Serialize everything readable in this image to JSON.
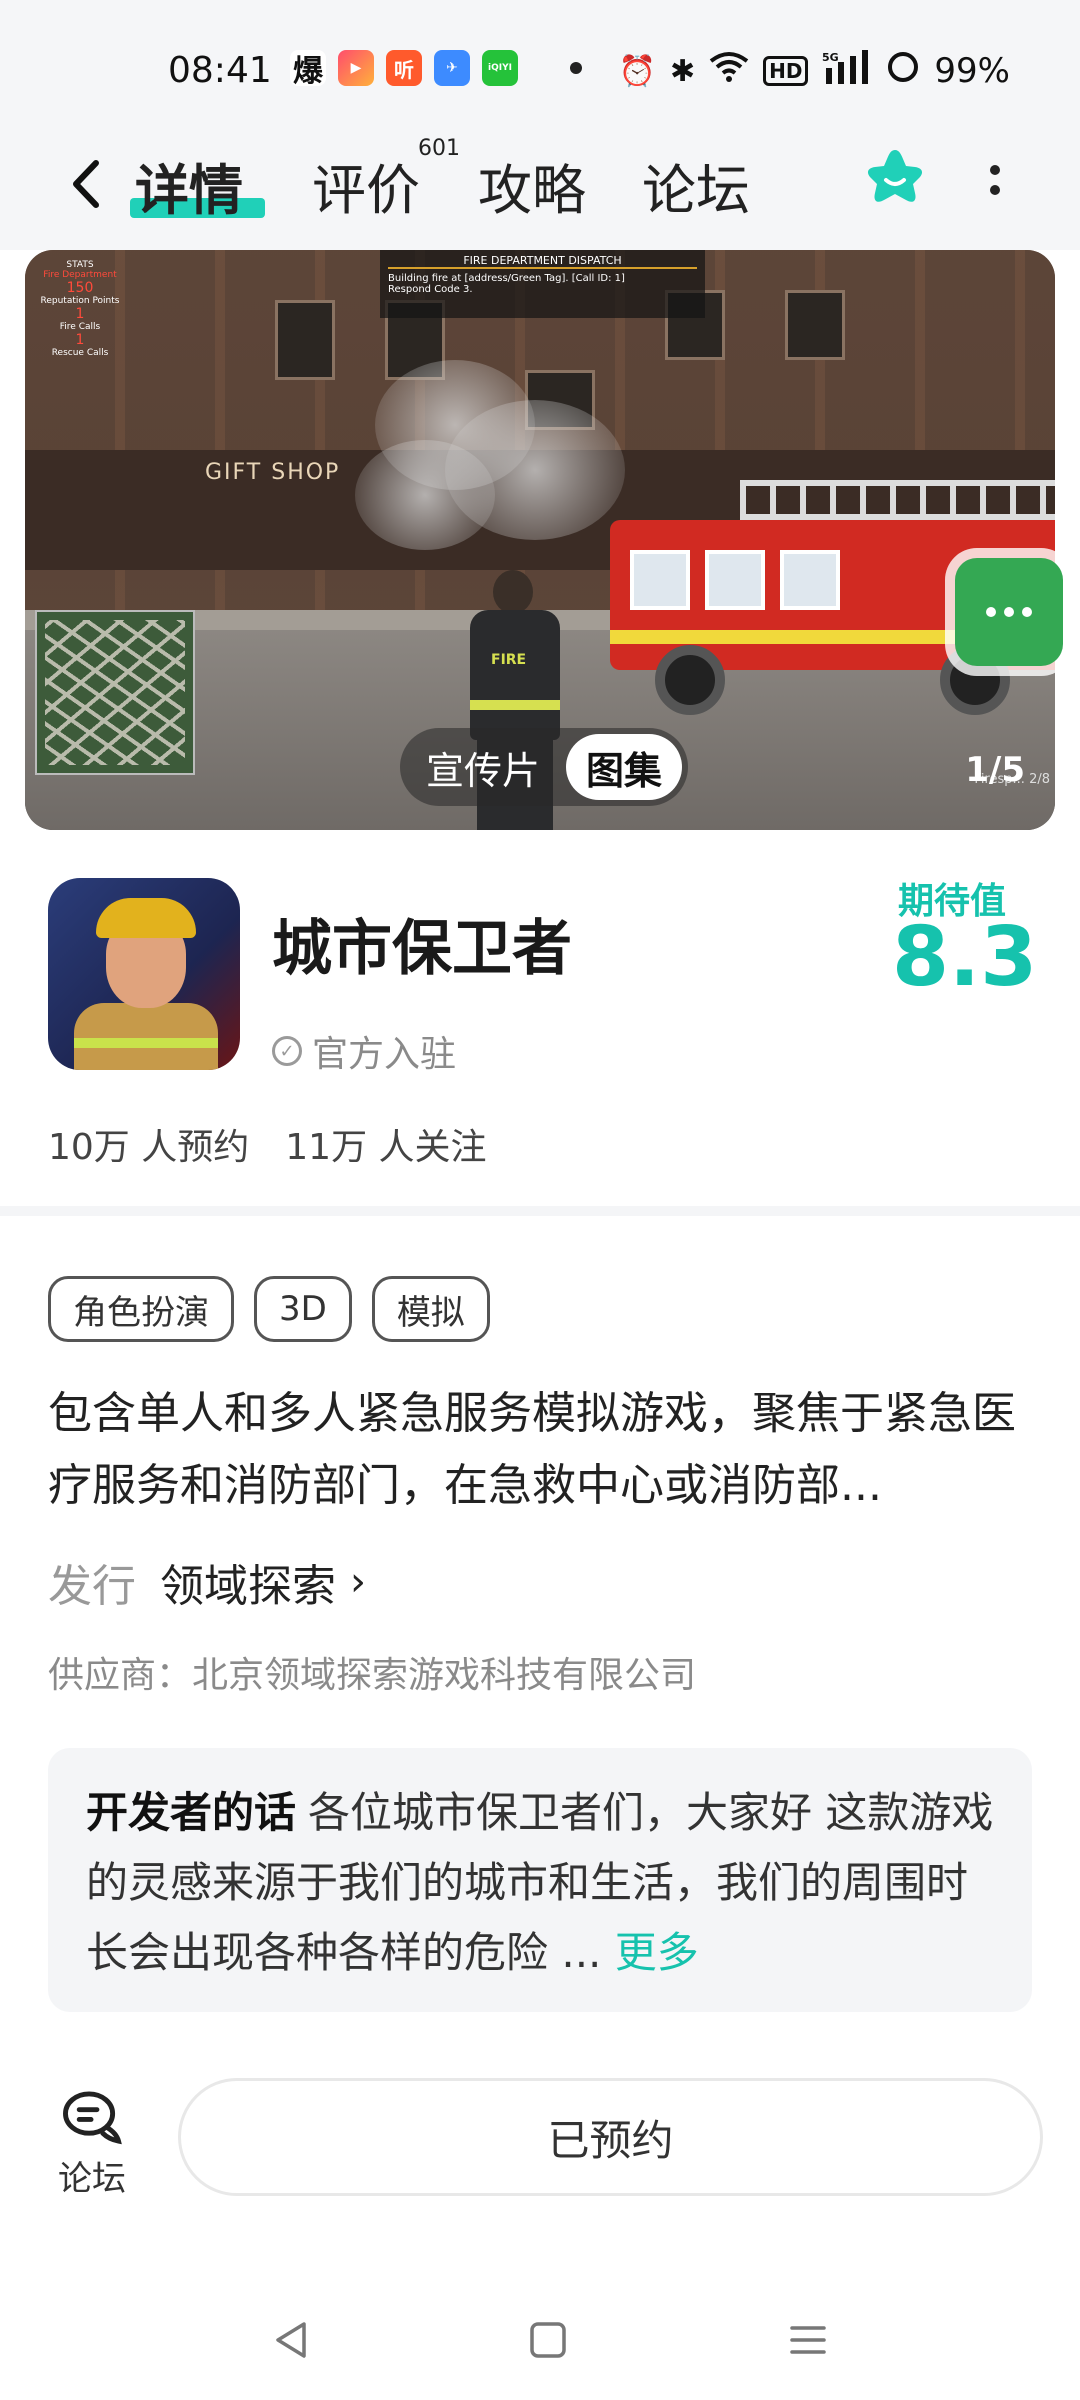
{
  "status_bar": {
    "time": "08:41",
    "battery": "99%",
    "icons": [
      "bao-icon",
      "app-icon",
      "ting-icon",
      "plane-icon",
      "iqiyi-icon",
      "alarm-icon",
      "bluetooth-icon",
      "wifi-icon",
      "hd-icon",
      "signal-icon"
    ],
    "signal_label": "5G",
    "hd_label": "HD",
    "apps": {
      "bao": "爆",
      "ting": "听",
      "iqiyi": "iQIYI"
    }
  },
  "nav": {
    "tabs": [
      {
        "label": "详情",
        "active": true
      },
      {
        "label": "评价",
        "badge": "601"
      },
      {
        "label": "攻略"
      },
      {
        "label": "论坛"
      }
    ]
  },
  "hero": {
    "toggle": [
      {
        "label": "宣传片",
        "active": false
      },
      {
        "label": "图集",
        "active": true
      }
    ],
    "counter": "1/5",
    "counter_sub": "Firesp... 2/8",
    "dispatch_title": "FIRE DEPARTMENT DISPATCH",
    "dispatch_line1": "Building fire at [address/Green Tag]. [Call ID: 1]",
    "dispatch_line2": "Respond Code 3.",
    "stats_title": "STATS",
    "stats_dept": "Fire Department",
    "stats_rep": "150",
    "stats_rep_label": "Reputation Points",
    "stats_fire": "1",
    "stats_fire_label": "Fire Calls",
    "stats_rescue": "1",
    "stats_rescue_label": "Rescue Calls",
    "shop_sign": "GIFT SHOP",
    "ff_text": "FIRE"
  },
  "game": {
    "title": "城市保卫者",
    "official": "官方入驻",
    "expect_label": "期待值",
    "expect_value": "8.3",
    "reservations": "10万 人预约",
    "followers": "11万 人关注",
    "tags": [
      "角色扮演",
      "3D",
      "模拟"
    ],
    "description": "包含单人和多人紧急服务模拟游戏，聚焦于紧急医疗服务和消防部门，在急救中心或消防部...",
    "publisher_label": "发行",
    "publisher_name": "领域探索",
    "supplier": "供应商：北京领域探索游戏科技有限公司",
    "dev_label": "开发者的话",
    "dev_text": "各位城市保卫者们，大家好 这款游戏的灵感来源于我们的城市和生活，我们的周围时长会出现各种各样的危险 ...",
    "dev_more": "更多"
  },
  "bottom": {
    "forum_label": "论坛",
    "reserve_label": "已预约"
  },
  "colors": {
    "accent": "#16c2ad",
    "chat_green": "#34a853"
  }
}
